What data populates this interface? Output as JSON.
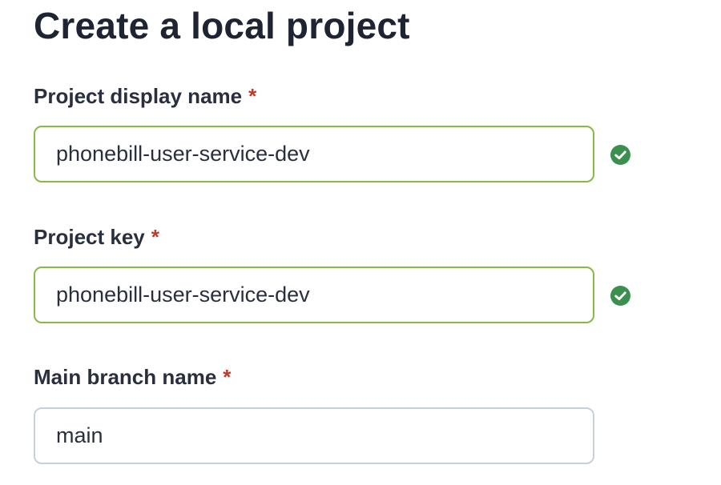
{
  "form": {
    "title": "Create a local project",
    "required_marker": "*",
    "fields": [
      {
        "label": "Project display name",
        "value": "phonebill-user-service-dev",
        "status": "valid"
      },
      {
        "label": "Project key",
        "value": "phonebill-user-service-dev",
        "status": "valid"
      },
      {
        "label": "Main branch name",
        "value": "main",
        "status": "neutral"
      }
    ]
  },
  "icons": {
    "valid": "check-circle-icon"
  },
  "colors": {
    "valid_border": "#8ab845",
    "check_icon": "#3d8f4e",
    "required": "#c0392b",
    "neutral_border": "#c7cfdb"
  }
}
